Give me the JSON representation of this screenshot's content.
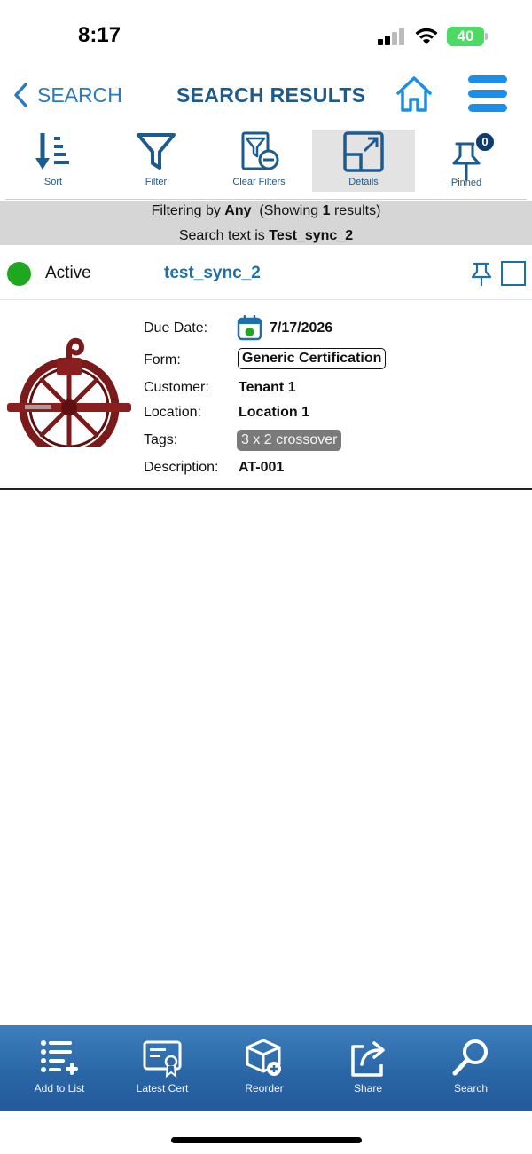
{
  "status_bar": {
    "time": "8:17",
    "battery": "40"
  },
  "nav": {
    "back_label": "SEARCH",
    "title": "SEARCH RESULTS"
  },
  "toolbar": {
    "sort_label": "Sort",
    "filter_label": "Filter",
    "clear_filters_label": "Clear Filters",
    "details_label": "Details",
    "pinned_label": "Pinned",
    "pinned_count": "0"
  },
  "filter_bar": {
    "prefix": "Filtering by",
    "mode": "Any",
    "showing_prefix": "(Showing",
    "count": "1",
    "showing_suffix": "results)",
    "search_prefix": "Search text is",
    "search_text": "Test_sync_2"
  },
  "result": {
    "status": "Active",
    "status_color": "#1fa81f",
    "name": "test_sync_2",
    "details": {
      "due_date_label": "Due Date:",
      "due_date": "7/17/2026",
      "form_label": "Form:",
      "form": "Generic Certification",
      "customer_label": "Customer:",
      "customer": "Tenant 1",
      "location_label": "Location:",
      "location": "Location 1",
      "tags_label": "Tags:",
      "tag": "3 x 2 crossover",
      "description_label": "Description:",
      "description": "AT-001"
    }
  },
  "bottom_bar": {
    "add_to_list": "Add to List",
    "latest_cert": "Latest Cert",
    "reorder": "Reorder",
    "share": "Share",
    "search": "Search"
  },
  "colors": {
    "accent": "#2a7ac0",
    "nav_title": "#1d5a8e",
    "bottom_bar": "#2a67a6"
  }
}
